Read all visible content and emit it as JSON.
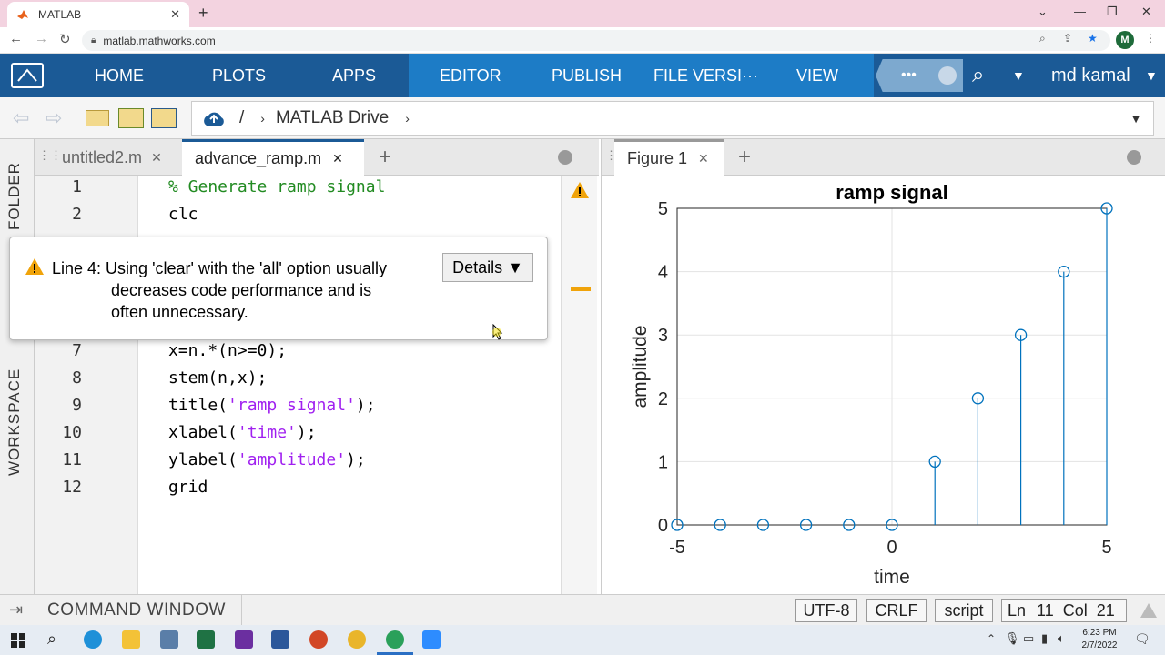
{
  "browser": {
    "tab_title": "MATLAB",
    "url": "matlab.mathworks.com",
    "profile_initial": "M"
  },
  "toolstrip": {
    "tabs": [
      "HOME",
      "PLOTS",
      "APPS",
      "EDITOR",
      "PUBLISH",
      "FILE VERSI···",
      "VIEW"
    ],
    "more": "•••",
    "user": "md kamal"
  },
  "path": {
    "root": "/",
    "folder": "MATLAB Drive"
  },
  "sidebar": {
    "folder_label": "FOLDER",
    "workspace_label": "WORKSPACE"
  },
  "editor": {
    "tabs": [
      {
        "label": "untitled2.m",
        "active": false
      },
      {
        "label": "advance_ramp.m",
        "active": true
      }
    ],
    "lines": [
      {
        "n": "1",
        "parts": [
          {
            "t": "% Generate ramp signal",
            "c": "cmt"
          }
        ]
      },
      {
        "n": "2",
        "parts": [
          {
            "t": "clc",
            "c": ""
          }
        ]
      },
      {
        "n": "7",
        "parts": [
          {
            "t": "x=n.*(n>=0);",
            "c": ""
          }
        ]
      },
      {
        "n": "8",
        "parts": [
          {
            "t": "stem(n,x);",
            "c": ""
          }
        ]
      },
      {
        "n": "9",
        "parts": [
          {
            "t": "title(",
            "c": ""
          },
          {
            "t": "'ramp signal'",
            "c": "str"
          },
          {
            "t": ");",
            "c": ""
          }
        ]
      },
      {
        "n": "10",
        "parts": [
          {
            "t": "xlabel(",
            "c": ""
          },
          {
            "t": "'time'",
            "c": "str"
          },
          {
            "t": ");",
            "c": ""
          }
        ]
      },
      {
        "n": "11",
        "parts": [
          {
            "t": "ylabel(",
            "c": ""
          },
          {
            "t": "'amplitude'",
            "c": "str"
          },
          {
            "t": ");",
            "c": ""
          }
        ]
      },
      {
        "n": "12",
        "parts": [
          {
            "t": "grid",
            "c": ""
          }
        ]
      }
    ]
  },
  "popup": {
    "line1": "Line 4: Using 'clear' with the 'all' option usually",
    "line2": "decreases code performance and is",
    "line3": "often unnecessary.",
    "details_label": "Details ▼"
  },
  "figure": {
    "tab_label": "Figure 1"
  },
  "chart_data": {
    "type": "scatter",
    "title": "ramp signal",
    "xlabel": "time",
    "ylabel": "amplitude",
    "x": [
      -5,
      -4,
      -3,
      -2,
      -1,
      0,
      1,
      2,
      3,
      4,
      5
    ],
    "y": [
      0,
      0,
      0,
      0,
      0,
      0,
      1,
      2,
      3,
      4,
      5
    ],
    "xlim": [
      -5,
      5
    ],
    "ylim": [
      0,
      5
    ],
    "xticks": [
      -5,
      0,
      5
    ],
    "yticks": [
      0,
      1,
      2,
      3,
      4,
      5
    ],
    "grid": true,
    "stem": true,
    "color": "#0072bd"
  },
  "statusbar": {
    "command_window": "COMMAND WINDOW",
    "encoding": "UTF-8",
    "line_ending": "CRLF",
    "mode": "script",
    "ln_label": "Ln",
    "ln": "11",
    "col_label": "Col",
    "col": "21"
  },
  "taskbar": {
    "time": "6:23 PM",
    "date": "2/7/2022"
  },
  "colors": {
    "toolstrip": "#1b5a96",
    "toolstrip_active": "#1d7cc6",
    "warning": "#f0a30a"
  }
}
